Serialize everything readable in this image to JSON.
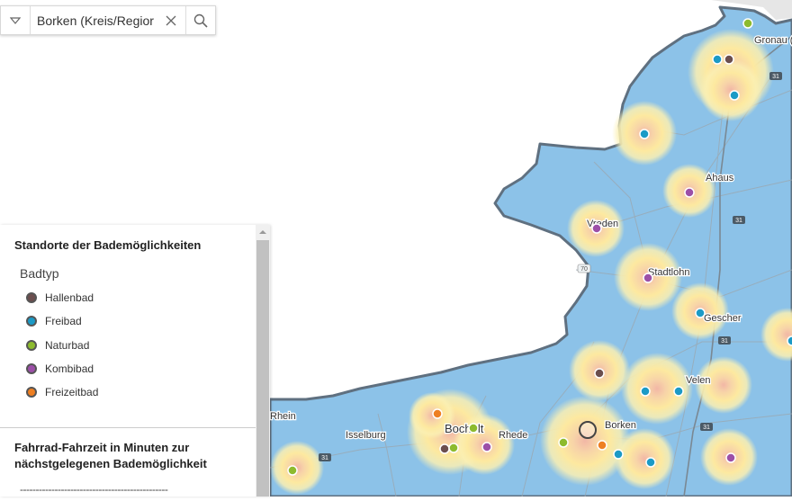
{
  "search": {
    "value": "Borken (Kreis/Regior",
    "dropdown_icon": "triangle-down-icon",
    "clear_icon": "close-icon",
    "search_icon": "search-icon"
  },
  "legend": {
    "title": "Standorte der Bademöglichkeiten",
    "subtitle": "Badtyp",
    "items": [
      {
        "label": "Hallenbad",
        "color": "#6b4e4e"
      },
      {
        "label": "Freibad",
        "color": "#1b9ac6"
      },
      {
        "label": "Naturbad",
        "color": "#8dbb2e"
      },
      {
        "label": "Kombibad",
        "color": "#9c4fa8"
      },
      {
        "label": "Freizeitbad",
        "color": "#ee7f22"
      }
    ],
    "section2_title": "Fahrrad-Fahrzeit in Minuten zur nächstgelegenen Bademöglichkeit",
    "dashes": "-----------------------------------------------"
  },
  "map": {
    "colors": {
      "region_fill": "#8cc2e8",
      "border": "#6a7c8c",
      "halo_outer": "#ffe9a6",
      "halo_inner": "#f4c4b0"
    },
    "places": [
      "Gronau (W",
      "Ahaus",
      "Vreden",
      "Stadtlohn",
      "Gescher",
      "Velen",
      "Borken",
      "Bocholt",
      "Rhede",
      "Isselburg",
      "Rhein"
    ],
    "road_shields": [
      "31",
      "70",
      "31",
      "31",
      "31",
      "31"
    ]
  }
}
